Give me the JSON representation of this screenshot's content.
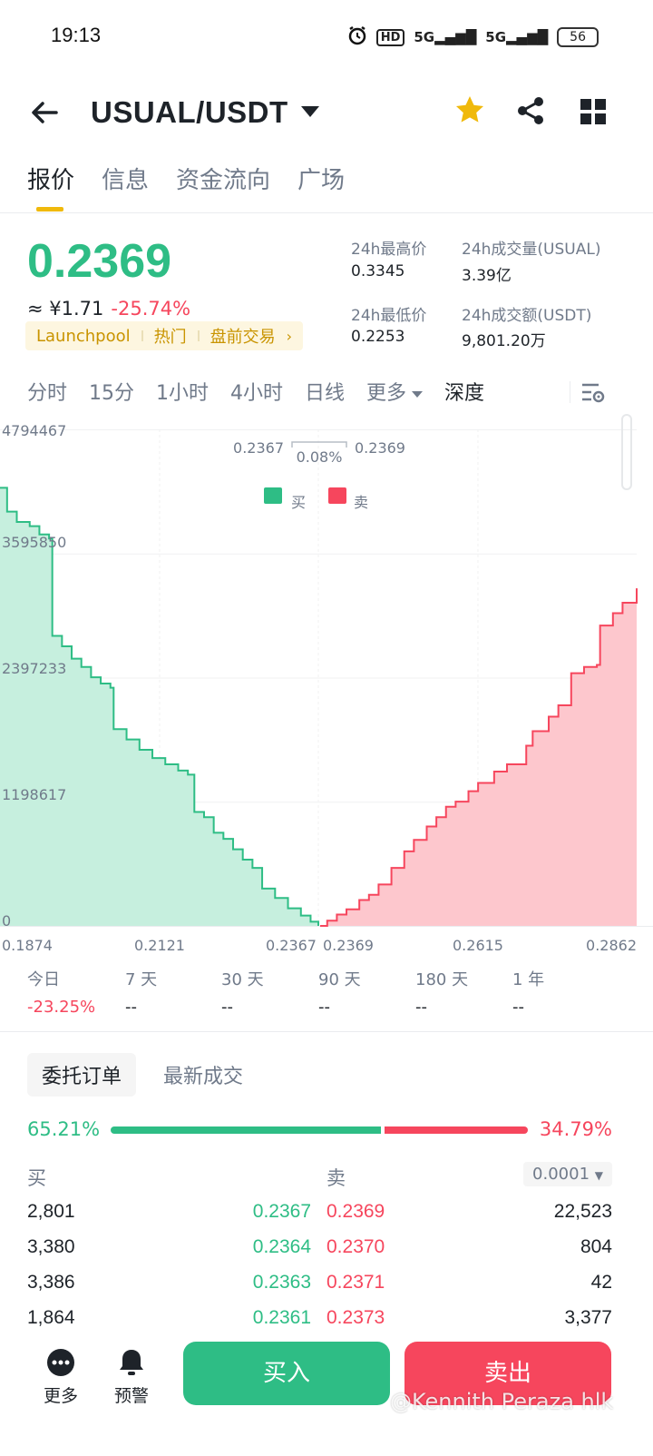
{
  "status_bar": {
    "time": "19:13",
    "hd": "HD",
    "net1": "5G",
    "net2": "5G",
    "battery": "56"
  },
  "header": {
    "pair": "USUAL/USDT"
  },
  "tabs": [
    "报价",
    "信息",
    "资金流向",
    "广场"
  ],
  "ticker": {
    "last_price": "0.2369",
    "cny": "≈ ¥1.71",
    "change": "-25.74%",
    "tags": [
      "Launchpool",
      "热门",
      "盘前交易"
    ],
    "high_label": "24h最高价",
    "high": "0.3345",
    "low_label": "24h最低价",
    "low": "0.2253",
    "vol_base_label": "24h成交量(USUAL)",
    "vol_base": "3.39亿",
    "vol_quote_label": "24h成交额(USDT)",
    "vol_quote": "9,801.20万"
  },
  "intervals": [
    "分时",
    "15分",
    "1小时",
    "4小时",
    "日线",
    "更多",
    "深度"
  ],
  "chart_data": {
    "type": "area",
    "y_ticks": [
      "4794467",
      "3595850",
      "2397233",
      "1198617",
      "0"
    ],
    "x_ticks": [
      "0.1874",
      "0.2121",
      "0.2367",
      "0.2369",
      "0.2615",
      "0.2862"
    ],
    "best_bid": "0.2367",
    "spread": "0.08%",
    "best_ask": "0.2369",
    "legend": [
      {
        "name": "买",
        "color": "#2ebd85"
      },
      {
        "name": "卖",
        "color": "#f6465d"
      }
    ],
    "xlim": [
      0.1874,
      0.2862
    ],
    "ylim": [
      0,
      4794467
    ],
    "bids": [
      [
        0.1874,
        4230000
      ],
      [
        0.1885,
        4000000
      ],
      [
        0.19,
        3900000
      ],
      [
        0.192,
        3860000
      ],
      [
        0.1935,
        3780000
      ],
      [
        0.195,
        3740000
      ],
      [
        0.1955,
        2800000
      ],
      [
        0.197,
        2700000
      ],
      [
        0.1985,
        2580000
      ],
      [
        0.2,
        2500000
      ],
      [
        0.2015,
        2400000
      ],
      [
        0.203,
        2340000
      ],
      [
        0.2045,
        2300000
      ],
      [
        0.205,
        1900000
      ],
      [
        0.207,
        1800000
      ],
      [
        0.209,
        1700000
      ],
      [
        0.211,
        1620000
      ],
      [
        0.213,
        1560000
      ],
      [
        0.215,
        1500000
      ],
      [
        0.2165,
        1460000
      ],
      [
        0.2175,
        1100000
      ],
      [
        0.219,
        1050000
      ],
      [
        0.2205,
        900000
      ],
      [
        0.222,
        840000
      ],
      [
        0.2235,
        740000
      ],
      [
        0.225,
        640000
      ],
      [
        0.2265,
        560000
      ],
      [
        0.228,
        360000
      ],
      [
        0.23,
        270000
      ],
      [
        0.232,
        170000
      ],
      [
        0.234,
        100000
      ],
      [
        0.2355,
        40000
      ],
      [
        0.2367,
        0
      ]
    ],
    "asks": [
      [
        0.2369,
        0
      ],
      [
        0.238,
        50000
      ],
      [
        0.2395,
        110000
      ],
      [
        0.241,
        160000
      ],
      [
        0.243,
        250000
      ],
      [
        0.2445,
        300000
      ],
      [
        0.246,
        400000
      ],
      [
        0.248,
        560000
      ],
      [
        0.25,
        720000
      ],
      [
        0.2515,
        830000
      ],
      [
        0.2535,
        960000
      ],
      [
        0.255,
        1050000
      ],
      [
        0.2565,
        1150000
      ],
      [
        0.258,
        1200000
      ],
      [
        0.26,
        1300000
      ],
      [
        0.2615,
        1380000
      ],
      [
        0.264,
        1490000
      ],
      [
        0.266,
        1560000
      ],
      [
        0.269,
        1740000
      ],
      [
        0.27,
        1880000
      ],
      [
        0.2725,
        2020000
      ],
      [
        0.274,
        2130000
      ],
      [
        0.276,
        2440000
      ],
      [
        0.278,
        2500000
      ],
      [
        0.28,
        2520000
      ],
      [
        0.2805,
        2900000
      ],
      [
        0.2825,
        3020000
      ],
      [
        0.284,
        3120000
      ],
      [
        0.2862,
        3260000
      ]
    ]
  },
  "performance": [
    {
      "label": "今日",
      "value": "-23.25%"
    },
    {
      "label": "7 天",
      "value": "--"
    },
    {
      "label": "30 天",
      "value": "--"
    },
    {
      "label": "90 天",
      "value": "--"
    },
    {
      "label": "180 天",
      "value": "--"
    },
    {
      "label": "1 年",
      "value": "--"
    }
  ],
  "orderbook": {
    "tabs": [
      "委托订单",
      "最新成交"
    ],
    "buy_pct": "65.21%",
    "sell_pct": "34.79%",
    "buy_ratio": 0.6521,
    "buy_label": "买",
    "sell_label": "卖",
    "precision": "0.0001",
    "rows": [
      {
        "bid_qty": "2,801",
        "bid": "0.2367",
        "ask": "0.2369",
        "ask_qty": "22,523"
      },
      {
        "bid_qty": "3,380",
        "bid": "0.2364",
        "ask": "0.2370",
        "ask_qty": "804"
      },
      {
        "bid_qty": "3,386",
        "bid": "0.2363",
        "ask": "0.2371",
        "ask_qty": "42"
      },
      {
        "bid_qty": "1,864",
        "bid": "0.2361",
        "ask": "0.2373",
        "ask_qty": "3,377"
      }
    ]
  },
  "bottom_bar": {
    "more": "更多",
    "alert": "预警",
    "buy": "买入",
    "sell": "卖出",
    "watermark": "@Kennith Peraza hlk"
  }
}
